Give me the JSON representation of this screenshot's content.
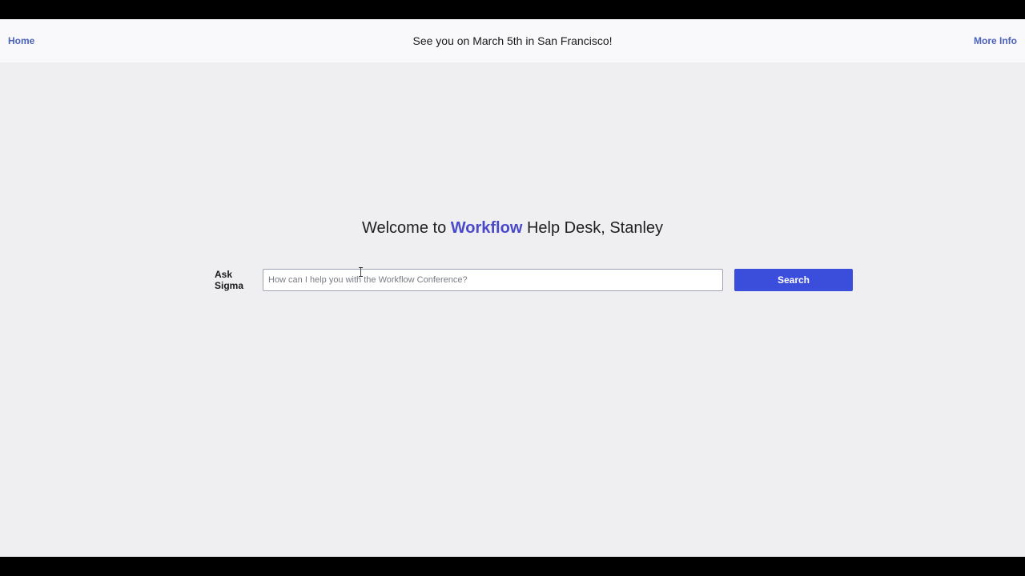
{
  "header": {
    "home_label": "Home",
    "announcement": "See you on March 5th in San Francisco!",
    "more_info_label": "More Info"
  },
  "welcome": {
    "prefix": "Welcome to ",
    "brand": "Workflow",
    "suffix": " Help Desk, Stanley"
  },
  "search": {
    "label": "Ask Sigma",
    "placeholder": "How can I help you with the Workflow Conference?",
    "value": "",
    "button_label": "Search"
  },
  "colors": {
    "accent": "#3b4ddb",
    "brand_text": "#4a49c9",
    "link": "#4a63b8",
    "background": "#efeef1"
  }
}
